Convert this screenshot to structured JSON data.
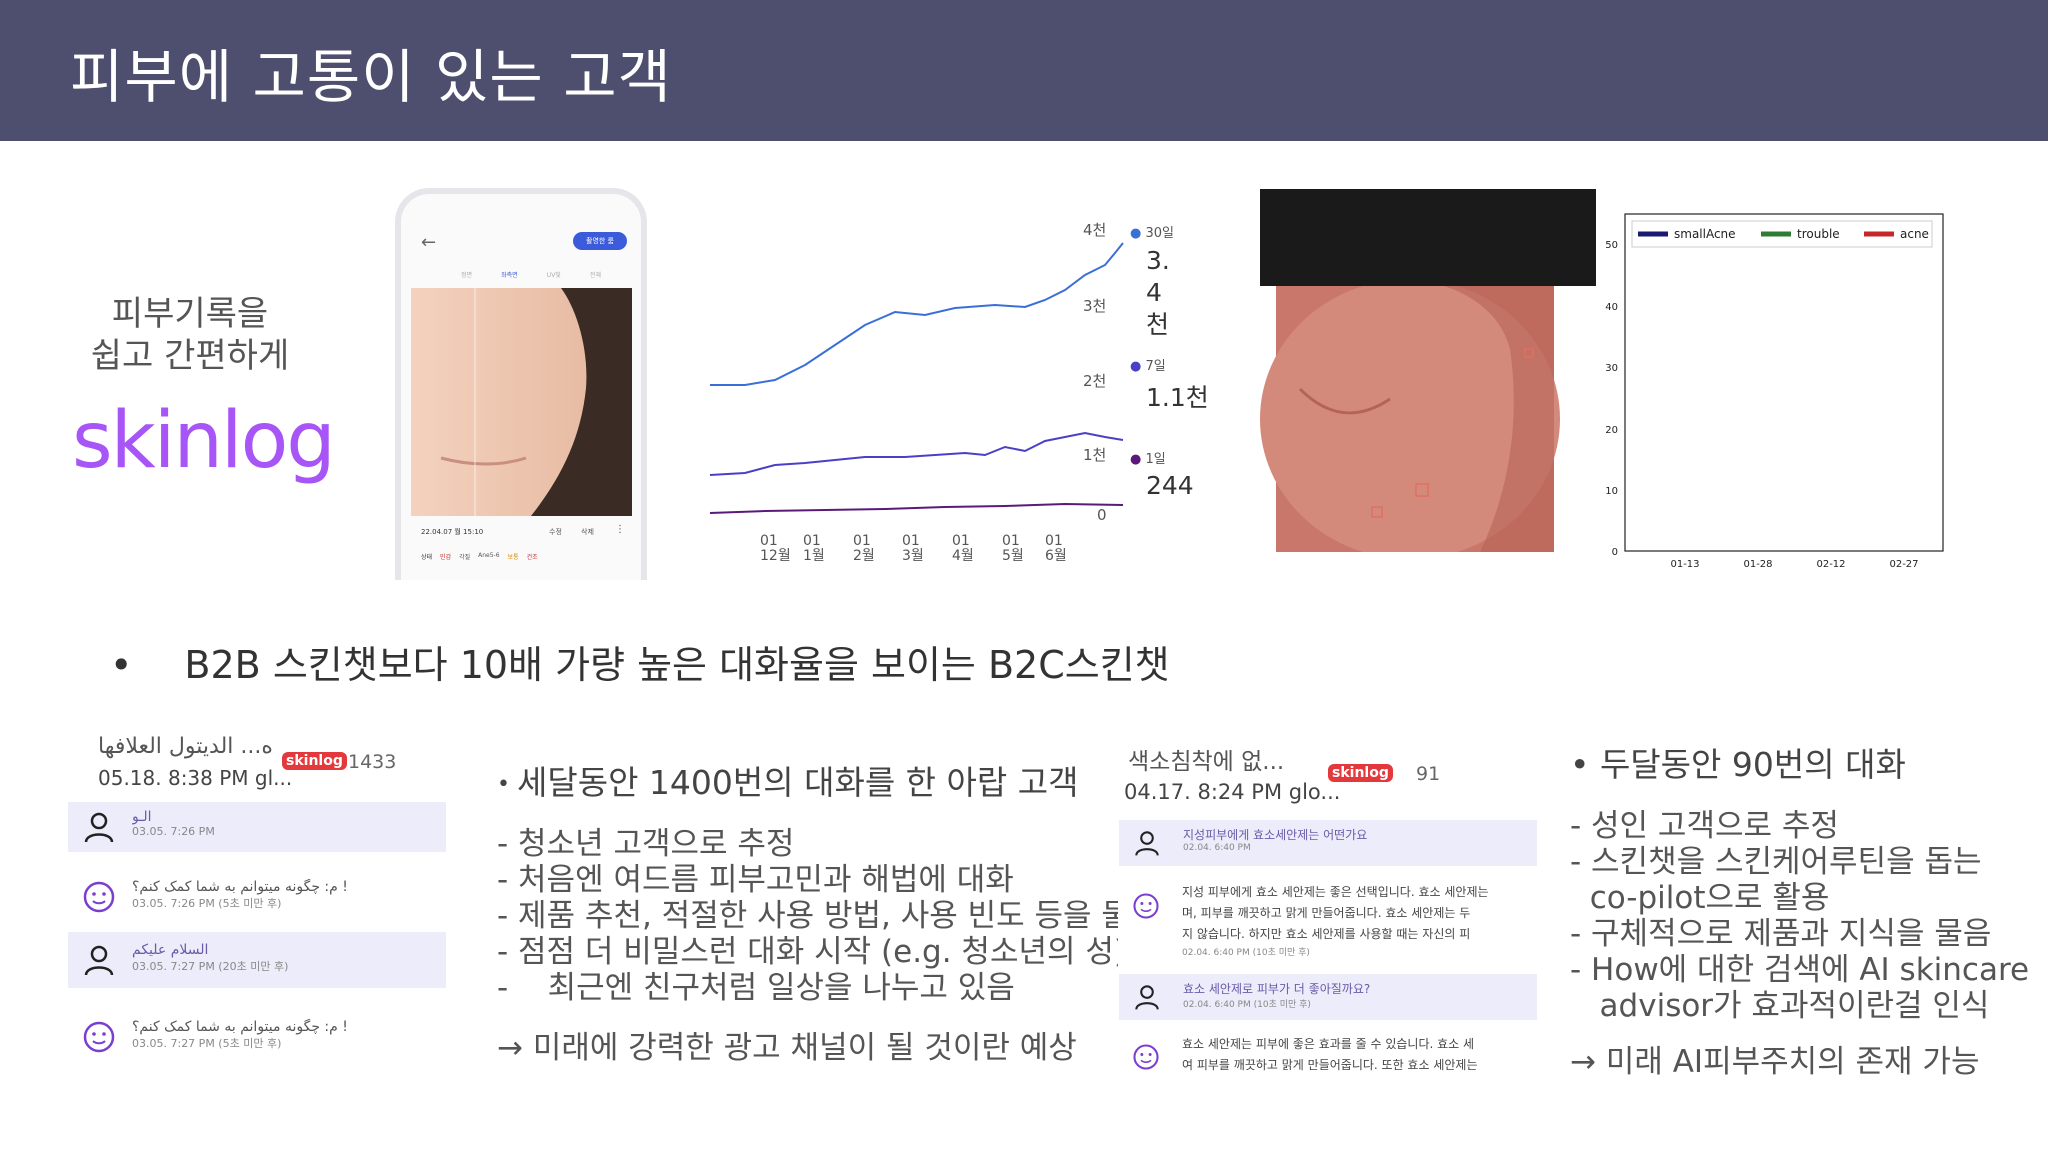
{
  "header": {
    "title": "피부에 고통이 있는 고객"
  },
  "brand": {
    "tagline_lines": [
      "피부기록을",
      "쉽고 간편하게"
    ],
    "logo": "skinlog",
    "logo_color": "#a855f7"
  },
  "phone": {
    "action_button": "촬영한 룸",
    "tabs": [
      "정면",
      "좌측면",
      "UV빛",
      "전체"
    ],
    "date": "22.04.07 월 15:10",
    "edit": "수정",
    "delete": "삭제",
    "status_label": "상태",
    "chips": [
      "민감",
      "각질",
      "Ane5-6",
      "보통",
      "건조"
    ]
  },
  "trend_chart": {
    "y_ticks": [
      "4천",
      "3천",
      "2천",
      "1천",
      "0"
    ],
    "x_ticks": [
      [
        "01",
        "12월"
      ],
      [
        "01",
        "1월"
      ],
      [
        "01",
        "2월"
      ],
      [
        "01",
        "3월"
      ],
      [
        "01",
        "4월"
      ],
      [
        "01",
        "5월"
      ],
      [
        "01",
        "6월"
      ]
    ],
    "legend": [
      {
        "label": "30일",
        "value": "3.4천",
        "color": "#3a6fd8"
      },
      {
        "label": "7일",
        "value": "1.1천",
        "color": "#4a40c8"
      },
      {
        "label": "1일",
        "value": "244",
        "color": "#5a1a7a"
      }
    ]
  },
  "acne_chart": {
    "legend": [
      {
        "name": "smallAcne",
        "color": "#1a1a70"
      },
      {
        "name": "trouble",
        "color": "#2e7d32"
      },
      {
        "name": "acne",
        "color": "#c62828"
      }
    ],
    "y_ticks": [
      "50",
      "40",
      "30",
      "20",
      "10",
      "0"
    ],
    "x_ticks": [
      "01-13",
      "01-28",
      "02-12",
      "02-27"
    ]
  },
  "main_bullet": "B2B 스킨챗보다 10배 가량 높은 대화율을 보이는 B2C스킨챗",
  "chat1": {
    "name": "ه... الديتول العلافها",
    "time": "05.18. 8:38 PM gl...",
    "badge": "skinlog",
    "count": "1433",
    "messages": [
      {
        "role": "user",
        "text": "الـو",
        "date": "03.05. 7:26 PM"
      },
      {
        "role": "bot",
        "text": "م: چگونه میتوانم به شما کمک کنم؟ !",
        "date": "03.05. 7:26 PM  (5초 미만 후)"
      },
      {
        "role": "user",
        "text": "السلام عليكم",
        "date": "03.05. 7:27 PM  (20초 미만 후)"
      },
      {
        "role": "bot",
        "text": "م: چگونه میتوانم به شما کمک کنم؟ !",
        "date": "03.05. 7:27 PM  (5초 미만 후)"
      }
    ]
  },
  "text1": {
    "heading": "세달동안 1400번의 대화를 한 아랍 고객",
    "lines": [
      "- 청소년 고객으로 추정",
      "- 처음엔 여드름 피부고민과 해법에 대화",
      "- 제품 추천, 적절한 사용 방법, 사용 빈도 등을 물음",
      "- 점점 더 비밀스런 대화 시작 (e.g. 청소년의 성)",
      "-    최근엔 친구처럼 일상을 나누고 있음"
    ],
    "conclusion": "→ 미래에 강력한 광고 채널이 될 것이란 예상"
  },
  "chat2": {
    "name": "색소침착에 없...",
    "time": "04.17. 8:24 PM glo...",
    "badge": "skinlog",
    "count": "91",
    "messages": [
      {
        "role": "user",
        "text": "지성피부에게 효소세안제는 어떤가요",
        "date": "02.04. 6:40 PM"
      },
      {
        "role": "bot",
        "lines": [
          "지성 피부에게 효소 세안제는 좋은 선택입니다. 효소 세안제는",
          "며, 피부를 깨끗하고 맑게 만들어줍니다. 효소 세안제는 두",
          "지 않습니다. 하지만 효소 세안제를 사용할 때는 자신의 피"
        ],
        "date": "02.04. 6:40 PM  (10초 미만 후)"
      },
      {
        "role": "user",
        "text": "효소 세안제로 피부가 더 좋아질까요?",
        "date": "02.04. 6:40 PM  (10초 미만 후)"
      },
      {
        "role": "bot",
        "lines": [
          "효소 세안제는 피부에 좋은 효과를 줄 수 있습니다. 효소 세",
          "여 피부를 깨끗하고 맑게 만들어줍니다. 또한 효소 세안제는"
        ],
        "date": ""
      }
    ]
  },
  "text2": {
    "heading": "• 두달동안 90번의 대화",
    "lines": [
      "- 성인 고객으로 추정",
      "- 스킨챗을 스킨케어루틴을 돕는",
      "  co-pilot으로 활용",
      "- 구체적으로 제품과 지식을 물음",
      "- How에 대한 검색에 AI skincare",
      "   advisor가 효과적이란걸 인식"
    ],
    "conclusion": "→ 미래 AI피부주치의 존재 가능"
  }
}
